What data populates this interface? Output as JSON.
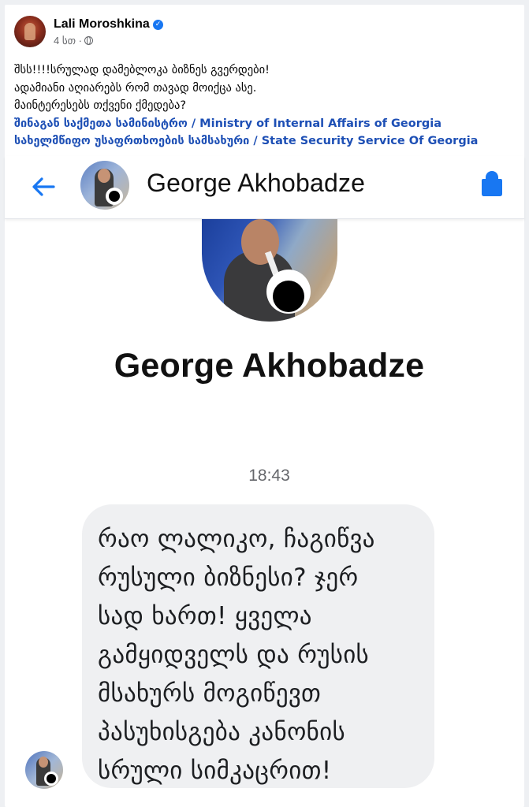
{
  "post": {
    "author": "Lali Moroshkina",
    "time": "4 სთ ·",
    "text_lines": [
      "შსს!!!!სრულად დამებლოკა ბიზნეს გვერდები!",
      "ადამიანი აღიარებს რომ თავად მოიქცა ასე.",
      "მაინტერესებს თქვენი ქმედება?"
    ],
    "tags": [
      "შინაგან საქმეთა სამინისტრო / Ministry of Internal Affairs of Georgia",
      "სახელმწიფო უსაფრთხოების სამსახური / State Security Service Of Georgia"
    ]
  },
  "messenger": {
    "contact_name": "George Akhobadze",
    "profile_name": "George Akhobadze",
    "timestamp": "18:43",
    "message_lines": [
      "რაო ლალიკო, ჩაგიწვა",
      "რუსული ბიზნესი? ჯერ",
      "სად ხართ! ყველა",
      "გამყიდველს და რუსის",
      "მსახურს მოგიწევთ",
      "პასუხისგება კანონის",
      "სრული სიმკაცრით!"
    ]
  },
  "colors": {
    "accent_blue": "#1877f2",
    "tag_blue": "#1d4fb5",
    "bubble": "#eff0f2"
  },
  "icons": {
    "back": "arrow-left-icon",
    "shield": "shield-icon",
    "verified": "verified-badge-icon",
    "audience": "globe-icon"
  }
}
